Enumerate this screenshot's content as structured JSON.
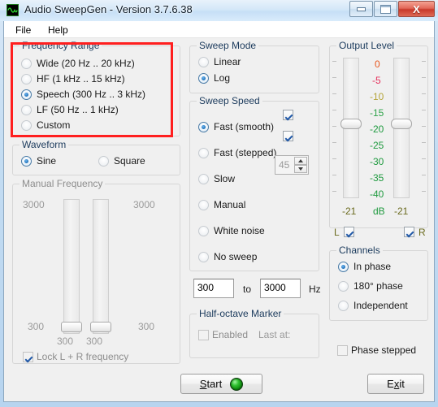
{
  "window": {
    "title": "Audio SweepGen - Version 3.7.6.38",
    "icon": "sine-wave-icon",
    "controls": {
      "minimize": "–",
      "maximize": "❐",
      "close": "X"
    }
  },
  "menu": {
    "items": [
      {
        "label": "File"
      },
      {
        "label": "Help"
      }
    ]
  },
  "frequency_range": {
    "title": "Frequency Range",
    "selected": "Speech  (300 Hz .. 3 kHz)",
    "options": [
      {
        "label": "Wide  (20 Hz .. 20 kHz)",
        "checked": false
      },
      {
        "label": "HF  (1 kHz .. 15 kHz)",
        "checked": false
      },
      {
        "label": "Speech  (300 Hz .. 3 kHz)",
        "checked": true
      },
      {
        "label": "LF  (50 Hz .. 1 kHz)",
        "checked": false
      },
      {
        "label": "Custom",
        "checked": false
      }
    ],
    "highlight_color": "#ff1f1f"
  },
  "waveform": {
    "title": "Waveform",
    "selected": "Sine",
    "options": [
      {
        "label": "Sine",
        "checked": true
      },
      {
        "label": "Square",
        "checked": false
      }
    ]
  },
  "manual_frequency": {
    "title": "Manual Frequency",
    "enabled": false,
    "left_max": "3000",
    "left_min": "300",
    "left_value": "300",
    "right_max": "3000",
    "right_min": "300",
    "right_value": "300",
    "lock_label": "Lock L + R frequency",
    "lock_checked": true
  },
  "sweep_mode": {
    "title": "Sweep Mode",
    "selected": "Log",
    "options": [
      {
        "label": "Linear",
        "checked": false
      },
      {
        "label": "Log",
        "checked": true
      }
    ]
  },
  "sweep_speed": {
    "title": "Sweep Speed",
    "selected": "Fast (smooth)",
    "options": [
      {
        "label": "Fast (smooth)",
        "checked": true
      },
      {
        "label": "Fast (stepped)",
        "checked": false
      },
      {
        "label": "Slow",
        "checked": false
      },
      {
        "label": "Manual",
        "checked": false
      },
      {
        "label": "White noise",
        "checked": false
      },
      {
        "label": "No sweep",
        "checked": false
      }
    ],
    "check_top": true,
    "check_bottom": true,
    "spinner_value": "45"
  },
  "range_fields": {
    "from_value": "300",
    "to_label": "to",
    "to_value": "3000",
    "unit": "Hz"
  },
  "half_octave": {
    "title": "Half-octave Marker",
    "enabled_label": "Enabled",
    "enabled_checked": false,
    "last_at_label": "Last at:"
  },
  "output_level": {
    "title": "Output Level",
    "scale": [
      {
        "label": "0",
        "color": "#e8571e"
      },
      {
        "label": "-5",
        "color": "#e6335e"
      },
      {
        "label": "-10",
        "color": "#b5a53a"
      },
      {
        "label": "-15",
        "color": "#2fa34a"
      },
      {
        "label": "-20",
        "color": "#1f9a3f"
      },
      {
        "label": "-25",
        "color": "#1f9a3f"
      },
      {
        "label": "-30",
        "color": "#1f9a3f"
      },
      {
        "label": "-35",
        "color": "#1f9a3f"
      },
      {
        "label": "-40",
        "color": "#1f9a3f"
      }
    ],
    "left_value": "-21",
    "right_value": "-21",
    "unit": "dB",
    "unit_color": "#1f9a3f",
    "value_color": "#6b6b1e",
    "left_channel_label": "L",
    "right_channel_label": "R",
    "left_checked": true,
    "right_checked": true
  },
  "channels": {
    "title": "Channels",
    "selected": "In phase",
    "options": [
      {
        "label": "In phase",
        "checked": true
      },
      {
        "label": "180° phase",
        "checked": false
      },
      {
        "label": "Independent",
        "checked": false
      }
    ],
    "phase_stepped_label": "Phase stepped",
    "phase_stepped_checked": false
  },
  "buttons": {
    "start": {
      "pre": "S",
      "post": "tart",
      "led": "green-led-icon"
    },
    "exit": {
      "pre": "E",
      "mid": "x",
      "post": "it"
    }
  }
}
